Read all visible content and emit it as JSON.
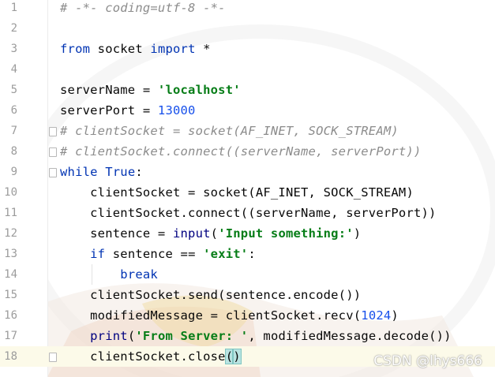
{
  "editor": {
    "lines": [
      {
        "num": "1",
        "tokens": [
          {
            "t": "# -*- coding=utf-8 -*-",
            "c": "cm"
          }
        ]
      },
      {
        "num": "2",
        "tokens": []
      },
      {
        "num": "3",
        "tokens": [
          {
            "t": "from",
            "c": "kw"
          },
          {
            "t": " socket "
          },
          {
            "t": "import",
            "c": "kw"
          },
          {
            "t": " *"
          }
        ]
      },
      {
        "num": "4",
        "tokens": []
      },
      {
        "num": "5",
        "tokens": [
          {
            "t": "serverName = "
          },
          {
            "t": "'localhost'",
            "c": "str"
          }
        ]
      },
      {
        "num": "6",
        "tokens": [
          {
            "t": "serverPort = "
          },
          {
            "t": "13000",
            "c": "num"
          }
        ]
      },
      {
        "num": "7",
        "fold": true,
        "tokens": [
          {
            "t": "# clientSocket = socket(AF_INET, SOCK_STREAM)",
            "c": "cm"
          }
        ]
      },
      {
        "num": "8",
        "fold": true,
        "tokens": [
          {
            "t": "# clientSocket.connect((serverName, serverPort))",
            "c": "cm"
          }
        ]
      },
      {
        "num": "9",
        "fold": true,
        "tokens": [
          {
            "t": "while",
            "c": "kw"
          },
          {
            "t": " "
          },
          {
            "t": "True",
            "c": "kw"
          },
          {
            "t": ":"
          }
        ]
      },
      {
        "num": "10",
        "tokens": [
          {
            "t": "    clientSocket = socket(AF_INET, SOCK_STREAM)"
          }
        ]
      },
      {
        "num": "11",
        "tokens": [
          {
            "t": "    clientSocket.connect((serverName, serverPort))"
          }
        ]
      },
      {
        "num": "12",
        "tokens": [
          {
            "t": "    sentence = "
          },
          {
            "t": "input",
            "c": "bi"
          },
          {
            "t": "("
          },
          {
            "t": "'Input something:'",
            "c": "str"
          },
          {
            "t": ")"
          }
        ]
      },
      {
        "num": "13",
        "tokens": [
          {
            "t": "    "
          },
          {
            "t": "if",
            "c": "kw"
          },
          {
            "t": " sentence == "
          },
          {
            "t": "'exit'",
            "c": "str"
          },
          {
            "t": ":"
          }
        ]
      },
      {
        "num": "14",
        "tokens": [
          {
            "t": "        "
          },
          {
            "t": "break",
            "c": "kw"
          }
        ]
      },
      {
        "num": "15",
        "tokens": [
          {
            "t": "    clientSocket.send(sentence.encode())"
          }
        ]
      },
      {
        "num": "16",
        "tokens": [
          {
            "t": "    modifiedMessage = clientSocket.recv("
          },
          {
            "t": "1024",
            "c": "num"
          },
          {
            "t": ")"
          }
        ]
      },
      {
        "num": "17",
        "tokens": [
          {
            "t": "    "
          },
          {
            "t": "print",
            "c": "bi"
          },
          {
            "t": "("
          },
          {
            "t": "'From Server: '",
            "c": "str"
          },
          {
            "t": ", modifiedMessage.decode())"
          }
        ]
      },
      {
        "num": "18",
        "current": true,
        "fold": true,
        "tokens": [
          {
            "t": "    clientSocket.close"
          },
          {
            "t": "(",
            "c": "paren-match"
          },
          {
            "t": ")",
            "c": "paren-match"
          }
        ]
      }
    ]
  },
  "watermark": "CSDN @lhys666",
  "colors": {
    "keyword": "#0033b3",
    "string": "#067d17",
    "number": "#1750eb",
    "comment": "#8c8c8c",
    "current_line": "#fcfae9"
  }
}
